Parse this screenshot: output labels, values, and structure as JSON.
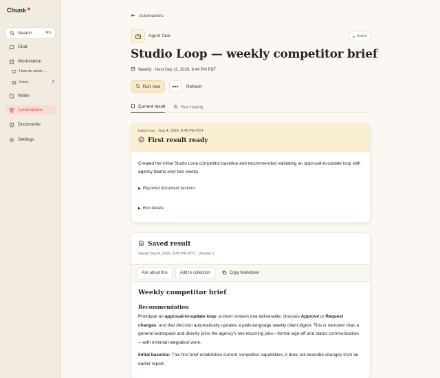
{
  "app": {
    "name": "Chunk",
    "brand_dot_color": "#e0443a"
  },
  "sidebar": {
    "search_label": "Search",
    "search_shortcut": "⌘K",
    "items": [
      {
        "label": "Chat",
        "icon": "chat-icon"
      },
      {
        "label": "Workstation",
        "icon": "workstation-icon"
      },
      {
        "label": "Notes",
        "icon": "notes-icon"
      },
      {
        "label": "Automations",
        "icon": "automations-icon",
        "active": true
      },
      {
        "label": "Documents",
        "icon": "documents-icon"
      },
      {
        "label": "Settings",
        "icon": "settings-icon"
      }
    ],
    "sub_items": [
      {
        "label": "How do urban ...",
        "icon": "thread-icon"
      },
      {
        "label": "Inbox",
        "count": "2",
        "icon": "inbox-icon"
      }
    ]
  },
  "breadcrumb": {
    "back_label": "Automations"
  },
  "task": {
    "type_label": "Agent Task",
    "status": "Active",
    "title": "Studio Loop — weekly competitor brief",
    "schedule": "Weekly · Next Sep 11, 2026, 8:44 PM PDT"
  },
  "toolbar": {
    "run_label": "Run now",
    "more_label": "•••",
    "refresh_label": "Refresh"
  },
  "tabs": [
    {
      "label": "Current result",
      "active": true
    },
    {
      "label": "Run history",
      "active": false
    }
  ],
  "latest_run": {
    "meta": "Latest run · Sep 4, 2026, 8:45 PM PDT",
    "heading": "First result ready",
    "summary": "Created the initial Studio Loop competitor baseline and recommended validating an approval-to-update loop with agency teams over two weeks.",
    "sections_label": "Reported document sections",
    "details_label": "Run details"
  },
  "saved_result": {
    "heading": "Saved result",
    "meta": "Saved Sep 4, 2026, 8:45 PM PDT · Version 1",
    "actions": {
      "ask": "Ask about this",
      "collection": "Add to collection",
      "copy": "Copy Markdown"
    },
    "doc": {
      "title": "Weekly competitor brief",
      "section": "Recommendation",
      "p1_a": "Prototype an ",
      "p1_b": "approval-to-update loop",
      "p1_c": ": a client reviews one deliverable, chooses ",
      "p1_d": "Approve",
      "p1_e": " or ",
      "p1_f": "Request changes",
      "p1_g": ", and that decision automatically updates a plain-language weekly client digest. This is narrower than a general workspace and directly joins the agency's two recurring jobs—formal sign-off and status communication—with minimal integration work.",
      "p2_a": "Initial baseline:",
      "p2_b": " This first brief establishes current competitor capabilities; it does not describe changes from an earlier report."
    }
  }
}
